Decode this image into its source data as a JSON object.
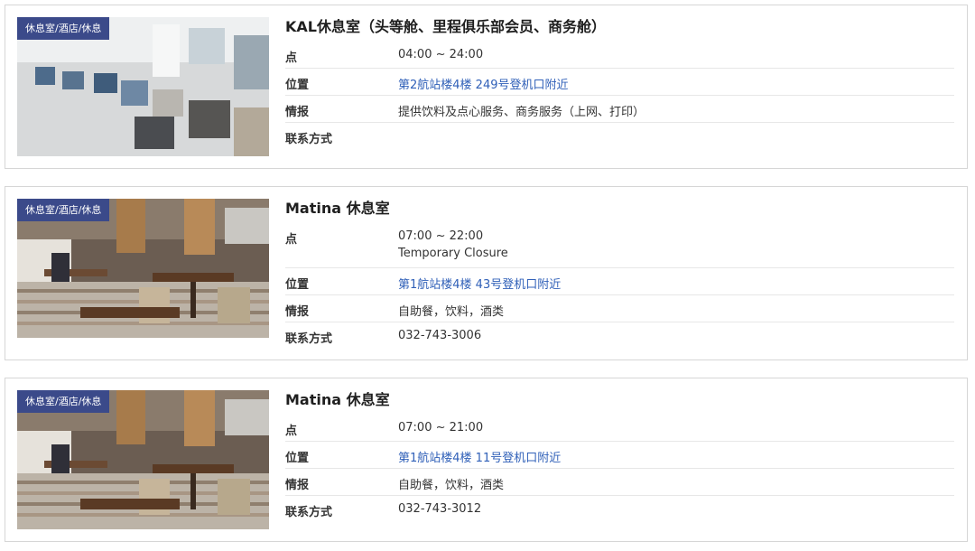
{
  "lounges": [
    {
      "category_badge": "休息室/酒店/休息",
      "title": "KAL休息室（头等舱、里程俱乐部会员、商务舱）",
      "rows": [
        {
          "label": "点",
          "value": "04:00 ~ 24:00",
          "sub": ""
        },
        {
          "label": "位置",
          "value": "第2航站楼4楼 249号登机口附近",
          "link": true
        },
        {
          "label": "情报",
          "value": "提供饮料及点心服务、商务服务（上网、打印）"
        },
        {
          "label": "联系方式",
          "value": ""
        }
      ]
    },
    {
      "category_badge": "休息室/酒店/休息",
      "title": "Matina 休息室",
      "rows": [
        {
          "label": "点",
          "value": "07:00 ~ 22:00",
          "sub": "Temporary Closure"
        },
        {
          "label": "位置",
          "value": "第1航站楼4楼 43号登机口附近",
          "link": true
        },
        {
          "label": "情报",
          "value": "自助餐，饮料，酒类"
        },
        {
          "label": "联系方式",
          "value": "032-743-3006"
        }
      ]
    },
    {
      "category_badge": "休息室/酒店/休息",
      "title": "Matina 休息室",
      "rows": [
        {
          "label": "点",
          "value": "07:00 ~ 21:00",
          "sub": ""
        },
        {
          "label": "位置",
          "value": "第1航站楼4楼 11号登机口附近",
          "link": true
        },
        {
          "label": "情报",
          "value": "自助餐，饮料，酒类"
        },
        {
          "label": "联系方式",
          "value": "032-743-3012"
        }
      ]
    }
  ],
  "colors": {
    "badge_bg": "#3b4a8a",
    "link": "#3060b8",
    "border": "#d6d6d6"
  }
}
